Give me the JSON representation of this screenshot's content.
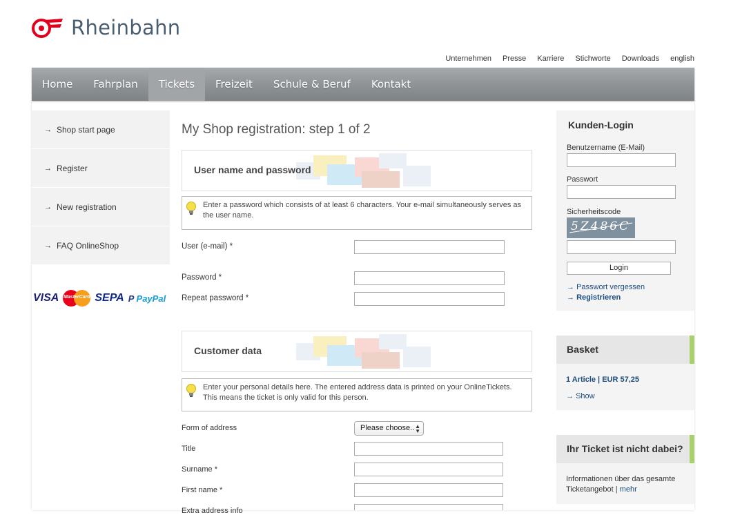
{
  "brand": {
    "name": "Rheinbahn",
    "logo_icon": "rheinbahn-logo-icon",
    "logo_color": "#e2001a"
  },
  "top_nav": [
    "Unternehmen",
    "Presse",
    "Karriere",
    "Stichworte",
    "Downloads",
    "english"
  ],
  "main_nav": {
    "items": [
      "Home",
      "Fahrplan",
      "Tickets",
      "Freizeit",
      "Schule & Beruf",
      "Kontakt"
    ],
    "active": "Tickets"
  },
  "left_nav": {
    "items": [
      "Shop start page",
      "Register",
      "New registration",
      "FAQ OnlineShop"
    ],
    "arrow_icon": "arrow-right-icon"
  },
  "payment_logos": [
    "VISA",
    "MasterCard",
    "SEPA",
    "PayPal"
  ],
  "main": {
    "title": "My Shop registration: step 1 of 2",
    "section1": {
      "title": "User name and password",
      "hint": "Enter a password which consists of at least 6 characters. Your e-mail simultaneously serves as the user name."
    },
    "fields1": [
      "User (e-mail) *",
      "Password *",
      "Repeat password *"
    ],
    "section2": {
      "title": "Customer data",
      "hint": "Enter your personal details here. The entered address data is printed on your OnlineTickets. This means the ticket is only valid for this person."
    },
    "fields2": [
      "Form of address",
      "Title",
      "Surname *",
      "First name *",
      "Extra address info"
    ],
    "form_of_address_select": "Please choose.."
  },
  "login": {
    "title": "Kunden-Login",
    "username_label": "Benutzername (E-Mail)",
    "password_label": "Passwort",
    "captcha_label": "Sicherheitscode",
    "captcha_text": "5Z486C",
    "login_button": "Login",
    "forgot_link": "Passwort vergessen",
    "register_link": "Registrieren"
  },
  "basket": {
    "title": "Basket",
    "summary": "1 Article | EUR 57,25",
    "show_link": "Show"
  },
  "ticket_info": {
    "title": "Ihr Ticket ist nicht dabei?",
    "text": "Informationen über das gesamte Ticketangebot |",
    "link": "mehr"
  },
  "colors": {
    "accent_green": "#a8d06b",
    "nav_gray": "#8e9295",
    "link_blue": "#1a4c80"
  }
}
